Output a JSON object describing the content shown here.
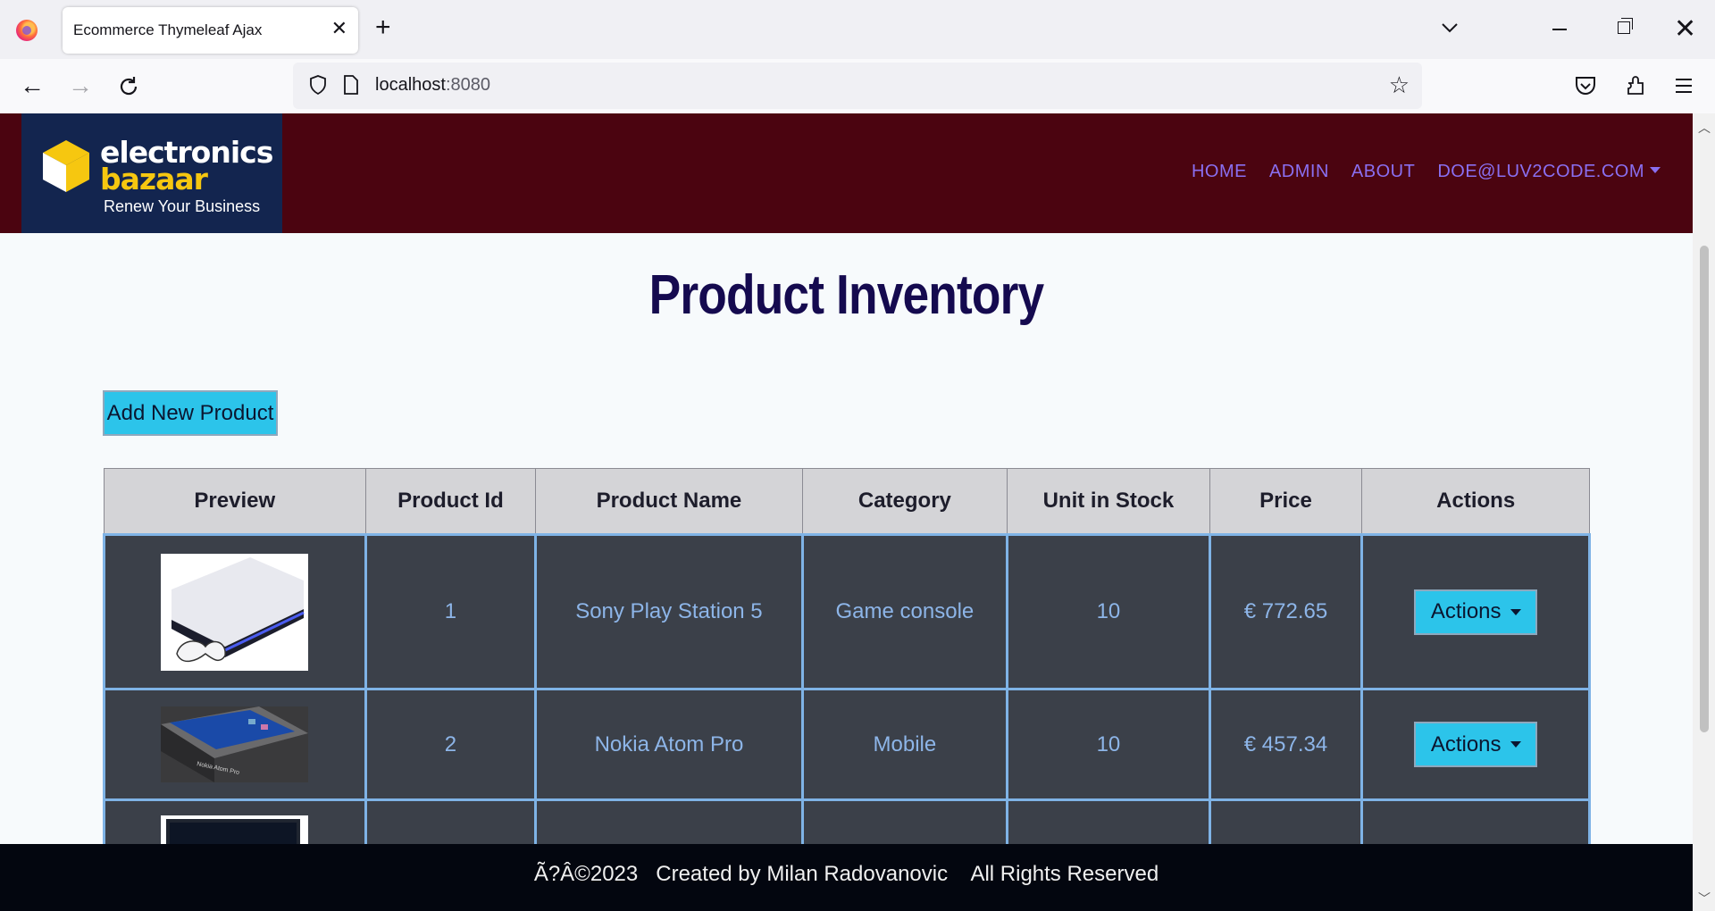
{
  "browser": {
    "tab_title": "Ecommerce Thymeleaf Ajax",
    "url_host": "localhost",
    "url_port": ":8080"
  },
  "header": {
    "logo": {
      "line1": "electronics",
      "line2": "bazaar",
      "tagline": "Renew Your Business"
    },
    "nav": [
      "HOME",
      "ADMIN",
      "ABOUT",
      "DOE@LUV2CODE.COM"
    ]
  },
  "main": {
    "title": "Product Inventory",
    "add_button": "Add New Product",
    "columns": [
      "Preview",
      "Product Id",
      "Product Name",
      "Category",
      "Unit in Stock",
      "Price",
      "Actions"
    ],
    "rows": [
      {
        "id": "1",
        "name": "Sony Play Station 5",
        "category": "Game console",
        "stock": "10",
        "price": "€ 772.65",
        "action": "Actions",
        "preview_icon": "playstation-image"
      },
      {
        "id": "2",
        "name": "Nokia Atom Pro",
        "category": "Mobile",
        "stock": "10",
        "price": "€ 457.34",
        "action": "Actions",
        "preview_icon": "phone-image",
        "preview_text": "Nokia Atom Pro"
      },
      {
        "id": "",
        "name": "",
        "category": "",
        "stock": "",
        "price": "",
        "action": "",
        "preview_icon": "laptop-image"
      }
    ]
  },
  "footer": {
    "text": "Ã?Â©2023   Created by Milan Radovanovic    All Rights Reserved"
  },
  "colors": {
    "header_bg": "#4b0410",
    "logo_bg": "#13254f",
    "nav_link": "#8a6ff0",
    "title": "#150a4f",
    "button": "#2cc4ea",
    "row_bg": "#3b4049",
    "row_text": "#8db5e8",
    "footer_bg": "#03060f"
  }
}
